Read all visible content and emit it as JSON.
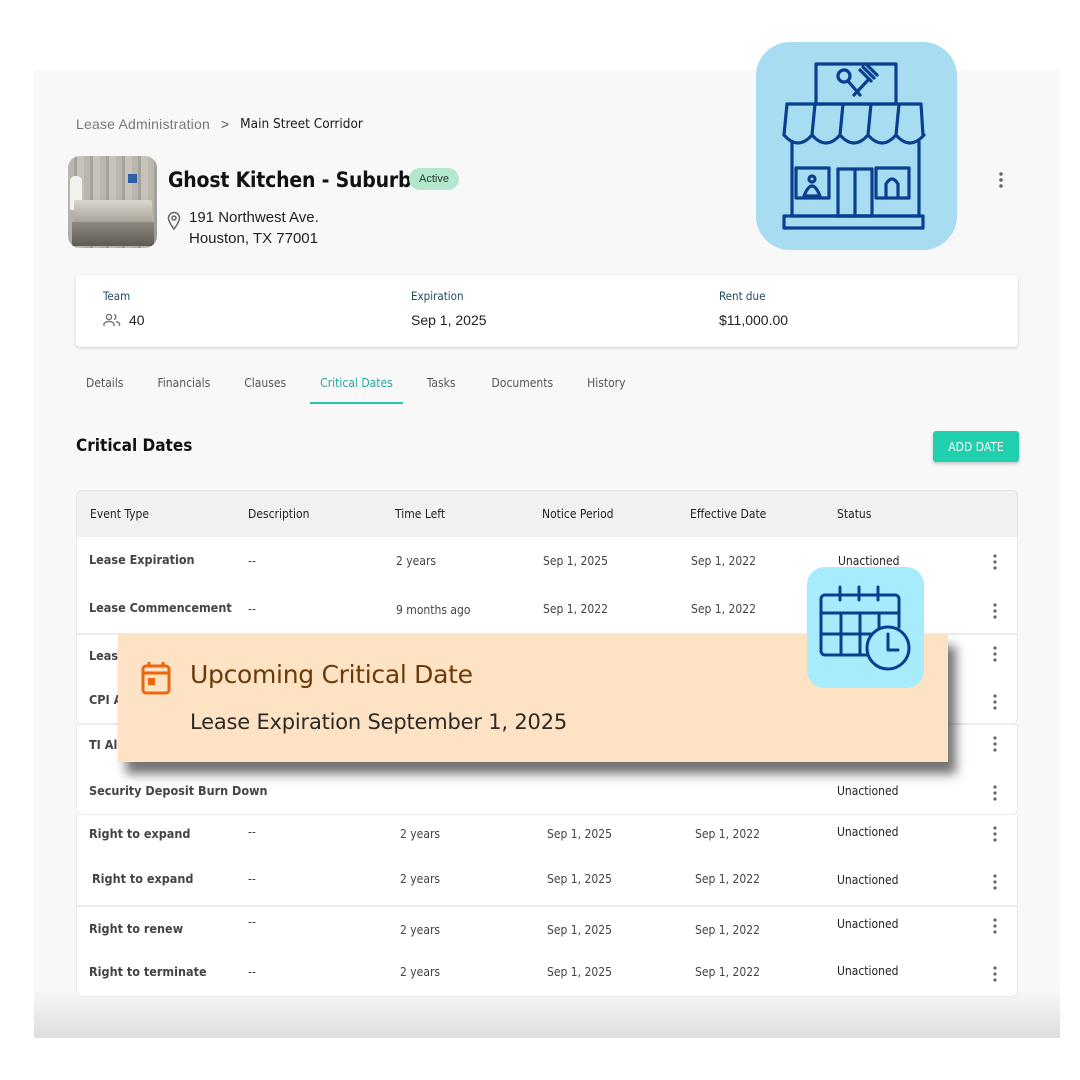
{
  "breadcrumb": {
    "items": [
      "Lease Administration",
      "Main Street Corridor"
    ],
    "separator": ">"
  },
  "property": {
    "title": "Ghost Kitchen - Suburbs",
    "status_badge": "Active",
    "address_line1": "191 Northwest Ave.",
    "address_line2": "Houston, TX 77001"
  },
  "summary": {
    "team_label": "Team",
    "team_value": "40",
    "expiration_label": "Expiration",
    "expiration_value": "Sep 1, 2025",
    "rent_label": "Rent due",
    "rent_value": "$11,000.00"
  },
  "tabs": [
    {
      "label": "Details",
      "active": false
    },
    {
      "label": "Financials",
      "active": false
    },
    {
      "label": "Clauses",
      "active": false
    },
    {
      "label": "Critical Dates",
      "active": true
    },
    {
      "label": "Tasks",
      "active": false
    },
    {
      "label": "Documents",
      "active": false
    },
    {
      "label": "History",
      "active": false
    }
  ],
  "section": {
    "title": "Critical Dates",
    "add_button": "ADD DATE"
  },
  "table": {
    "columns": [
      "Event Type",
      "Description",
      "Time Left",
      "Notice Period",
      "Effective Date",
      "Status"
    ],
    "rows": [
      {
        "event": "Lease Expiration",
        "description": "--",
        "time_left": "2 years",
        "notice": "Sep 1, 2025",
        "effective": "Sep 1, 2022",
        "status": "Unactioned"
      },
      {
        "event": "Lease Commencement",
        "description": "--",
        "time_left": "9 months ago",
        "notice": "Sep 1, 2022",
        "effective": "Sep 1, 2022",
        "status": ""
      },
      {
        "event": "Leas",
        "description": "",
        "time_left": "",
        "notice": "",
        "effective": "",
        "status": ""
      },
      {
        "event": "CPI A",
        "description": "",
        "time_left": "",
        "notice": "",
        "effective": "",
        "status": ""
      },
      {
        "event": "TI Al",
        "description": "",
        "time_left": "",
        "notice": "",
        "effective": "",
        "status": ""
      },
      {
        "event": "Security Deposit Burn Down",
        "description": "",
        "time_left": "",
        "notice": "",
        "effective": "",
        "status": "Unactioned"
      },
      {
        "event": "Right to expand",
        "description": "--",
        "time_left": "2 years",
        "notice": "Sep 1, 2025",
        "effective": "Sep 1, 2022",
        "status": "Unactioned"
      },
      {
        "event": "Right to expand",
        "description": "--",
        "time_left": "2 years",
        "notice": "Sep 1, 2025",
        "effective": "Sep 1, 2022",
        "status": "Unactioned"
      },
      {
        "event": "Right to renew",
        "description": "--",
        "time_left": "2 years",
        "notice": "Sep 1, 2025",
        "effective": "Sep 1, 2022",
        "status": "Unactioned"
      },
      {
        "event": "Right to terminate",
        "description": "--",
        "time_left": "2 years",
        "notice": "Sep 1, 2025",
        "effective": "Sep 1, 2022",
        "status": "Unactioned"
      }
    ]
  },
  "toast": {
    "icon": "calendar-icon",
    "title": "Upcoming Critical Date",
    "message": "Lease Expiration September 1, 2025"
  },
  "icons": {
    "brand_tile": "storefront-restaurant-icon",
    "calendar_tile": "calendar-clock-icon",
    "location": "map-pin-icon",
    "team": "people-icon",
    "menu": "more-vertical-icon"
  },
  "colors": {
    "accent": "#1fcfae",
    "tab_active": "#2aa79b",
    "badge_bg": "#b4e8cd",
    "toast_bg": "#fde2c4",
    "toast_icon": "#e8670f",
    "brand_tile_bg": "#a8dcf0",
    "calendar_tile_bg": "#a6ecfc",
    "icon_stroke": "#0a3f8f"
  }
}
